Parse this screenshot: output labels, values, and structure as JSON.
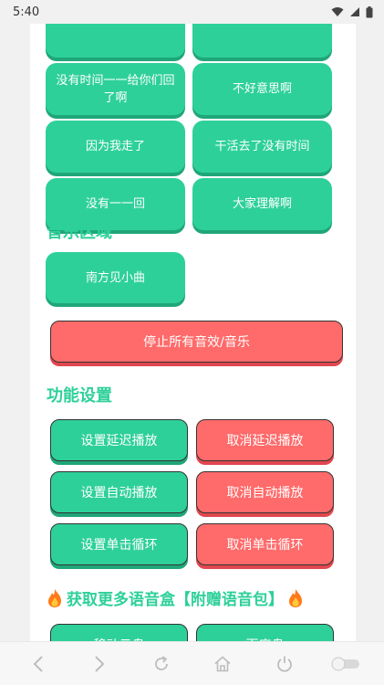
{
  "status_bar": {
    "time": "5:40"
  },
  "colors": {
    "green": "#2ed09a",
    "red": "#ff6a6a",
    "page_bg": "#ffffff"
  },
  "sound_buttons": [
    {
      "label": ""
    },
    {
      "label": ""
    },
    {
      "label": "没有时间一一给你们回了啊"
    },
    {
      "label": "不好意思啊"
    },
    {
      "label": "因为我走了"
    },
    {
      "label": "干活去了没有时间"
    },
    {
      "label": "没有一一回"
    },
    {
      "label": "大家理解啊"
    }
  ],
  "music_section": {
    "title": "音乐区域",
    "button": "南方见小曲"
  },
  "stop_button": "停止所有音效/音乐",
  "settings_section": {
    "title": "功能设置",
    "buttons": [
      "设置延迟播放",
      "取消延迟播放",
      "设置自动播放",
      "取消自动播放",
      "设置单击循环",
      "取消单击循环"
    ]
  },
  "promo_title": "获取更多语音盒【附赠语音包】",
  "bottom_buttons": [
    "移动云盘",
    "百度盘"
  ],
  "nav_icons": [
    "back-icon",
    "forward-icon",
    "refresh-icon",
    "home-icon",
    "power-icon",
    "toggle-icon"
  ]
}
